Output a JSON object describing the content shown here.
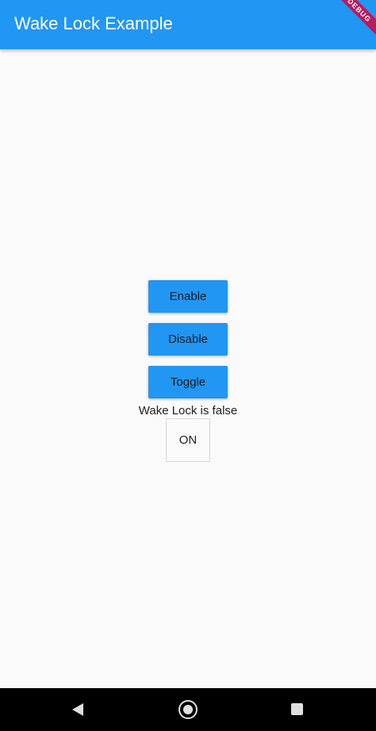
{
  "appbar": {
    "title": "Wake Lock Example",
    "debug_banner": "DEBUG"
  },
  "buttons": {
    "enable_label": "Enable",
    "disable_label": "Disable",
    "toggle_label": "Toggle"
  },
  "status": {
    "text": "Wake Lock is false"
  },
  "switch_box": {
    "label": "ON"
  },
  "colors": {
    "primary": "#2196f3",
    "background": "#fafafa",
    "navbar": "#000000"
  },
  "navbar": {
    "icons": [
      "back-icon",
      "home-icon",
      "recent-apps-icon"
    ]
  }
}
